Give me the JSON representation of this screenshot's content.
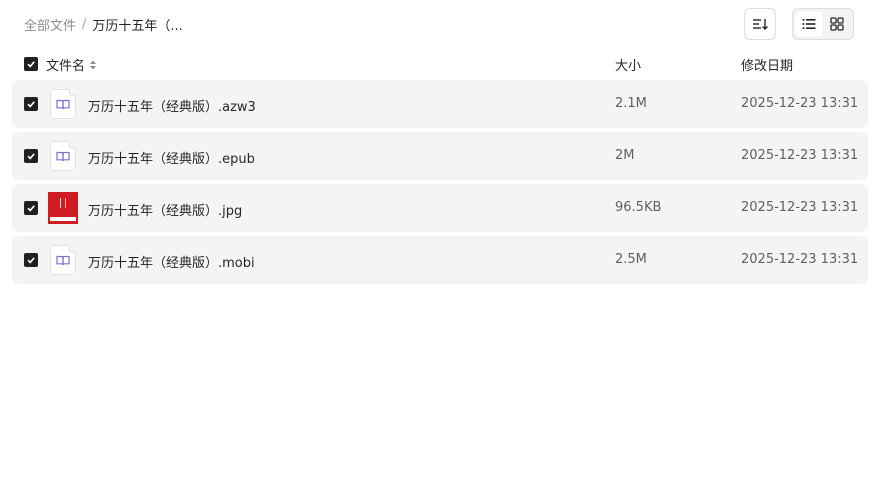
{
  "breadcrumb": {
    "root": "全部文件",
    "separator": "/",
    "current": "万历十五年（..."
  },
  "toolbar": {
    "sort_icon": "sort-lines-icon",
    "view_list_icon": "list-view-icon",
    "view_grid_icon": "grid-view-icon",
    "active_view": "list"
  },
  "table": {
    "headers": {
      "name": "文件名",
      "size": "大小",
      "date": "修改日期"
    },
    "select_all_checked": true,
    "rows": [
      {
        "name": "万历十五年（经典版）.azw3",
        "size": "2.1M",
        "date": "2025-12-23 13:31",
        "icon": "ebook-icon",
        "checked": true
      },
      {
        "name": "万历十五年（经典版）.epub",
        "size": "2M",
        "date": "2025-12-23 13:31",
        "icon": "ebook-icon",
        "checked": true
      },
      {
        "name": "万历十五年（经典版）.jpg",
        "size": "96.5KB",
        "date": "2025-12-23 13:31",
        "icon": "image-thumbnail",
        "checked": true
      },
      {
        "name": "万历十五年（经典版）.mobi",
        "size": "2.5M",
        "date": "2025-12-23 13:31",
        "icon": "ebook-icon",
        "checked": true
      }
    ]
  },
  "colors": {
    "row_bg": "#f4f4f5",
    "checkbox": "#1f2023",
    "ebook_icon": "#7b6fd6",
    "cover_red": "#d11b22"
  }
}
